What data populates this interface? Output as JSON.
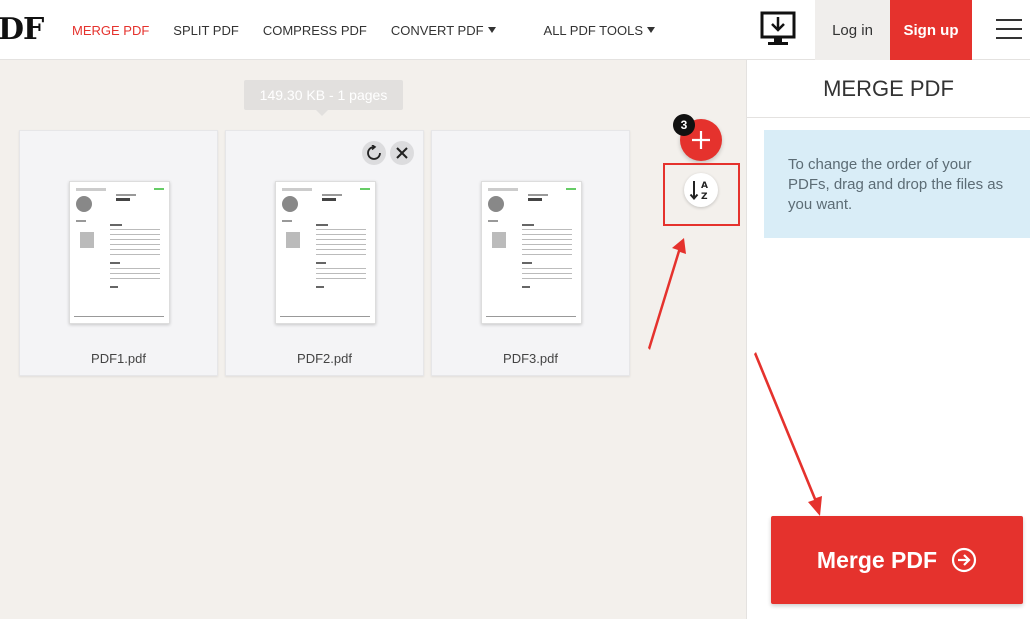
{
  "header": {
    "logo": "DF",
    "nav": [
      {
        "label": "MERGE PDF",
        "active": true,
        "dropdown": false
      },
      {
        "label": "SPLIT PDF",
        "active": false,
        "dropdown": false
      },
      {
        "label": "COMPRESS PDF",
        "active": false,
        "dropdown": false
      },
      {
        "label": "CONVERT PDF",
        "active": false,
        "dropdown": true
      },
      {
        "label": "ALL PDF TOOLS",
        "active": false,
        "dropdown": true
      }
    ],
    "desktop_icon": "desktop-download-icon",
    "login_label": "Log in",
    "signup_label": "Sign up",
    "menu_icon": "hamburger-icon"
  },
  "tooltip": "149.30 KB - 1 pages",
  "files": [
    {
      "name": "PDF1.pdf"
    },
    {
      "name": "PDF2.pdf"
    },
    {
      "name": "PDF3.pdf"
    }
  ],
  "file_actions": {
    "rotate_icon": "rotate-icon",
    "remove_icon": "close-icon"
  },
  "add_files": {
    "count": "3",
    "icon": "plus-icon"
  },
  "sort": {
    "icon": "sort-az-icon",
    "letters_top": "A",
    "letters_bottom": "Z"
  },
  "sidebar": {
    "title": "MERGE PDF",
    "info": "To change the order of your PDFs, drag and drop the files as you want.",
    "merge_label": "Merge PDF",
    "merge_icon": "arrow-circle-right-icon"
  },
  "colors": {
    "accent": "#e5322d",
    "info_bg": "#d9edf7",
    "page_bg": "#f3f0ec"
  }
}
